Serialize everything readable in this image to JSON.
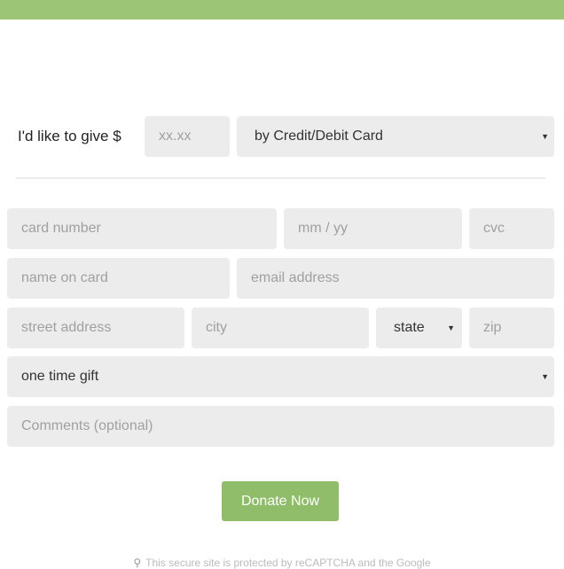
{
  "colors": {
    "accent": "#9cc576",
    "button": "#8fbd6a",
    "field_bg": "#ececec",
    "placeholder": "#a0a0a0",
    "text": "#222222"
  },
  "give": {
    "label": "I'd like to give $",
    "amount_placeholder": "xx.xx",
    "method_selected": "by Credit/Debit Card"
  },
  "card": {
    "number_placeholder": "card number",
    "expiry_placeholder": "mm / yy",
    "cvc_placeholder": "cvc",
    "name_placeholder": "name on card",
    "email_placeholder": "email address"
  },
  "address": {
    "street_placeholder": "street address",
    "city_placeholder": "city",
    "state_selected": "state",
    "zip_placeholder": "zip"
  },
  "frequency": {
    "selected": "one time gift"
  },
  "comments": {
    "placeholder": "Comments (optional)"
  },
  "donate_button": {
    "label": "Donate Now"
  },
  "footer": {
    "recaptcha_text": "This secure site is protected by reCAPTCHA and the Google",
    "icon": "map-pin-icon"
  },
  "icons": {
    "select_caret": "caret-down-icon"
  }
}
